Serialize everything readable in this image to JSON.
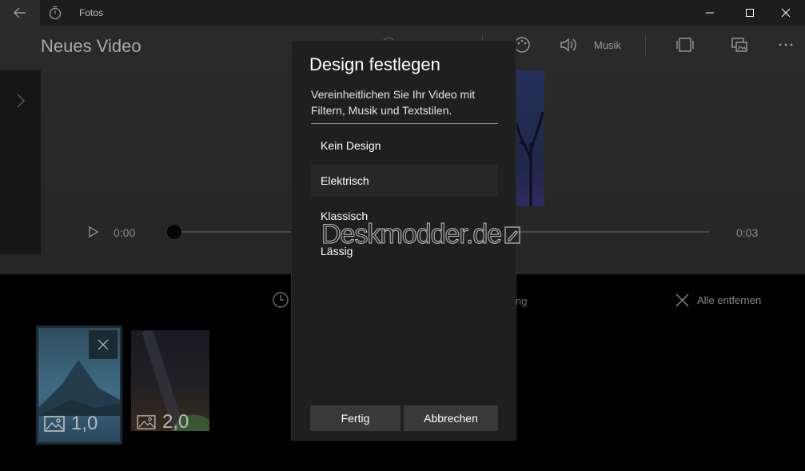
{
  "window": {
    "app_title": "Fotos"
  },
  "editor": {
    "project_title": "Neues Video",
    "toolbar": {
      "music_label": "Musik"
    },
    "playback": {
      "current_time": "0:00",
      "total_time": "0:03"
    }
  },
  "storyboard": {
    "partial_label": "ng",
    "remove_all_label": "Alle entfernen",
    "cards": [
      {
        "duration": "1,0"
      },
      {
        "duration": "2,0"
      }
    ]
  },
  "dialog": {
    "title": "Design festlegen",
    "description": "Vereinheitlichen Sie Ihr Video mit Filtern, Musik und Textstilen.",
    "options": [
      {
        "label": "Kein Design",
        "selected": false
      },
      {
        "label": "Elektrisch",
        "selected": true
      },
      {
        "label": "Klassisch",
        "selected": false
      },
      {
        "label": "Lässig",
        "selected": false
      }
    ],
    "ok_label": "Fertig",
    "cancel_label": "Abbrechen"
  },
  "watermark": {
    "text": "Deskmodder.de"
  },
  "colors": {
    "dialog_bg": "#1f1f1f",
    "button_bg": "#393939",
    "selected_option_bg": "#272727"
  }
}
